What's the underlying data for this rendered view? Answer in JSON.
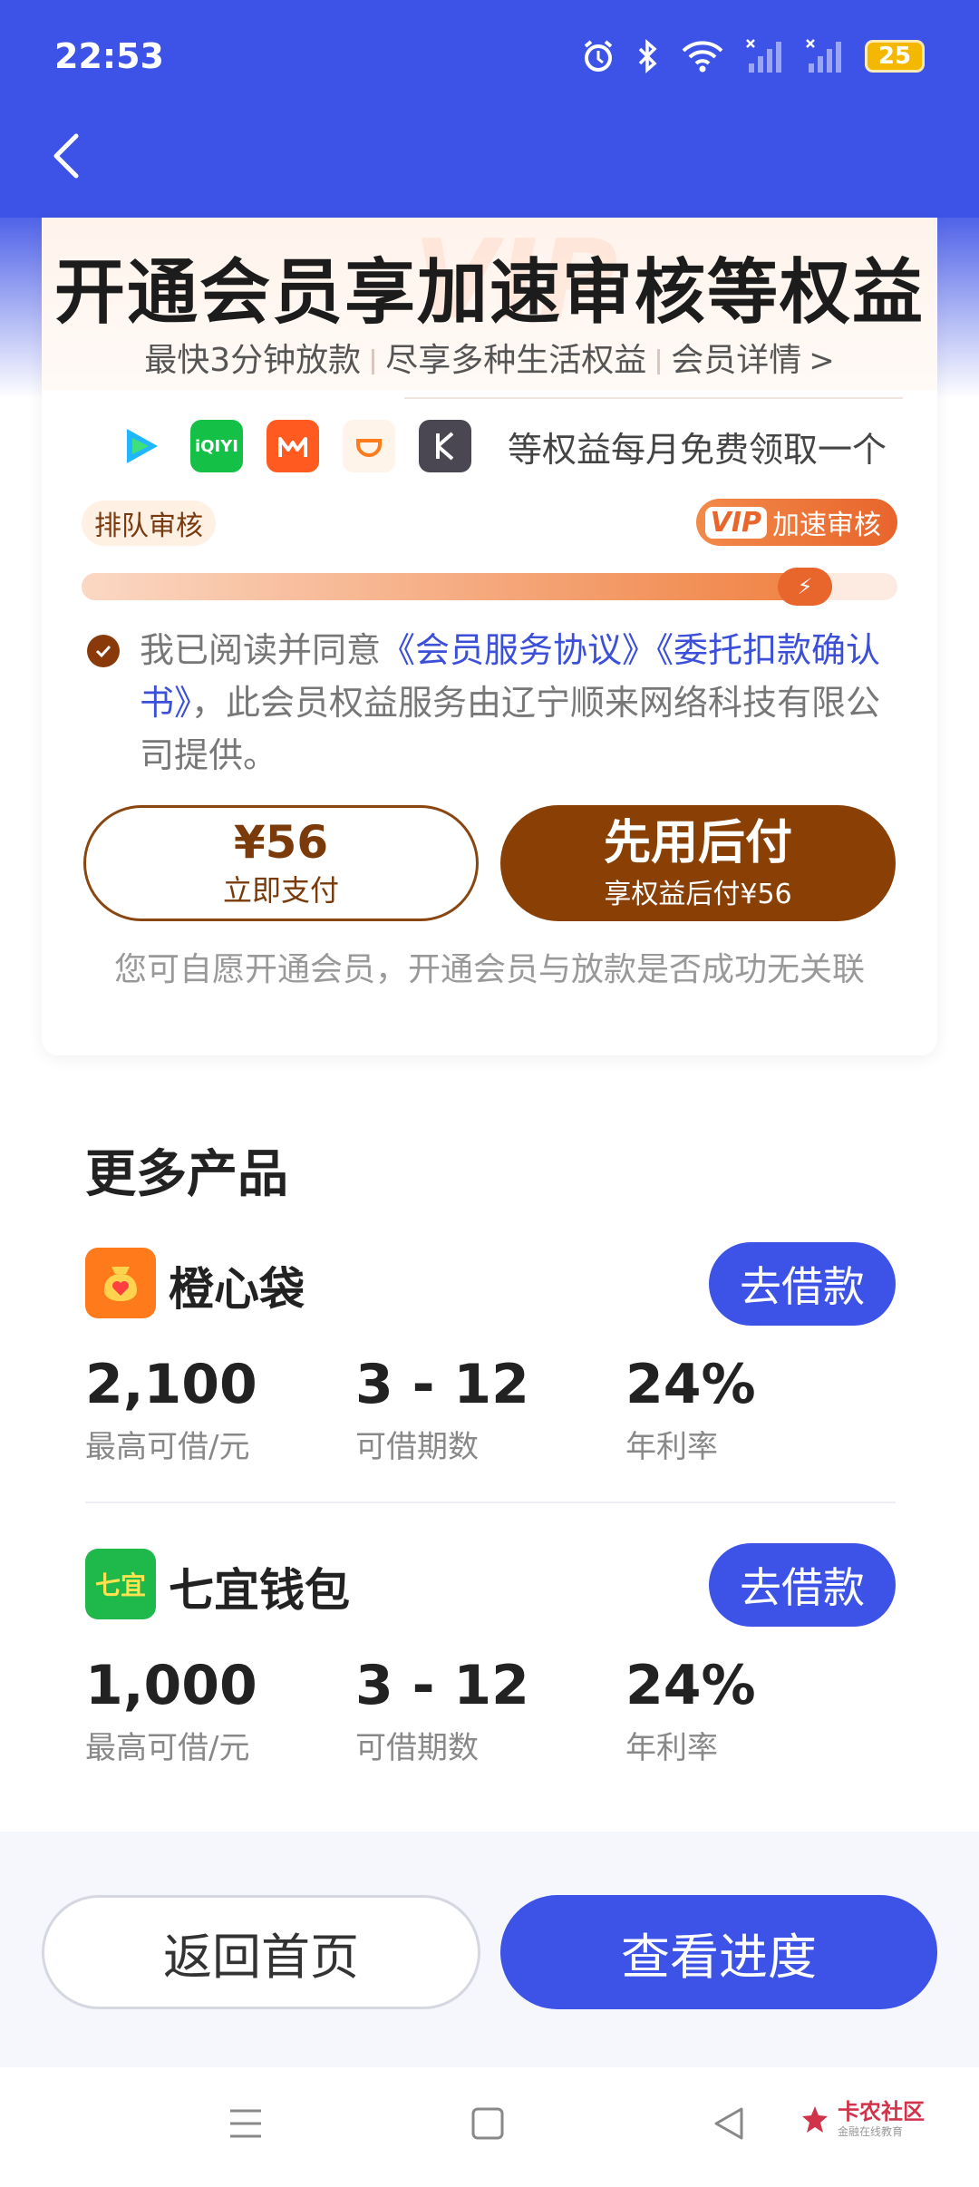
{
  "status_bar": {
    "time": "22:53",
    "battery": "25"
  },
  "member_card": {
    "watermark": "VIP",
    "title": "开通会员享加速审核等权益",
    "subtitle_items": [
      "最快3分钟放款",
      "尽享多种生活权益",
      "会员详情"
    ],
    "apps": [
      {
        "name": "tencent-video-icon",
        "color": "#1fb7ff"
      },
      {
        "name": "iqiyi-icon",
        "label": "iQIYI",
        "color": "#15c047"
      },
      {
        "name": "mango-tv-icon",
        "color": "#ff5a1f"
      },
      {
        "name": "didi-icon",
        "color": "#fff4ea"
      },
      {
        "name": "keep-icon",
        "color": "#4a4652"
      }
    ],
    "apps_text": "等权益每月免费领取一个",
    "queue_label": "排队审核",
    "vip_label": "加速审核",
    "vip_mark": "VIP",
    "progress": 0.92,
    "agree_prefix": "我已阅读并同意",
    "agree_link1": "《会员服务协议》",
    "agree_link2": "《委托扣款确认书》",
    "agree_suffix": "，此会员权益服务由辽宁顺来网络科技有限公司提供。",
    "pay_price": "¥56",
    "pay_label": "立即支付",
    "later_main": "先用后付",
    "later_label": "享权益后付¥56",
    "note": "您可自愿开通会员，开通会员与放款是否成功无关联"
  },
  "more_products": {
    "title": "更多产品",
    "items": [
      {
        "name": "橙心袋",
        "button": "去借款",
        "stats": [
          {
            "value": "2,100",
            "caption": "最高可借/元"
          },
          {
            "value": "3 - 12",
            "caption": "可借期数"
          },
          {
            "value": "24%",
            "caption": "年利率"
          }
        ]
      },
      {
        "name": "七宜钱包",
        "icon_text": "七宜",
        "button": "去借款",
        "stats": [
          {
            "value": "1,000",
            "caption": "最高可借/元"
          },
          {
            "value": "3 - 12",
            "caption": "可借期数"
          },
          {
            "value": "24%",
            "caption": "年利率"
          }
        ]
      }
    ]
  },
  "actions": {
    "home": "返回首页",
    "progress": "查看进度"
  },
  "watermark": {
    "title": "卡农社区",
    "subtitle": "金融在线教育"
  },
  "colors": {
    "primary": "#3d52e6",
    "brown": "#8a3f05",
    "orange": "#e8652c"
  }
}
